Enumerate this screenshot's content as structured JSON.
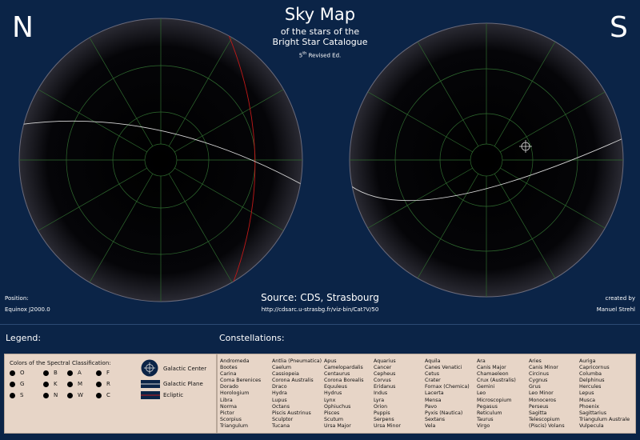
{
  "hemispheres": {
    "north": "N",
    "south": "S"
  },
  "title": {
    "main": "Sky Map",
    "line2": "of the stars of the",
    "line3": "Bright Star Catalogue",
    "edition_sup": "5th",
    "edition_text": "Revised Ed."
  },
  "position": {
    "label": "Position:",
    "equinox": "Equinox J2000.0"
  },
  "source": {
    "label": "Source: CDS, Strasbourg",
    "url": "http://cdsarc.u-strasbg.fr/viz-bin/Cat?V/50"
  },
  "credit": {
    "line1": "created by",
    "line2": "Manuel Strehl"
  },
  "legend": {
    "heading": "Legend:",
    "spectral_title": "Colors of the Spectral Classification:",
    "classes": [
      "O",
      "B",
      "A",
      "F",
      "G",
      "K",
      "M",
      "R",
      "S",
      "N",
      "W",
      "C"
    ],
    "galactic_center": "Galactic Center",
    "galactic_plane": "Galactic Plane",
    "ecliptic": "Ecliptic"
  },
  "constellations": {
    "heading": "Constellations:",
    "columns": [
      [
        "Andromeda",
        "Bootes",
        "Carina",
        "Coma Berenices",
        "Dorado",
        "Horologium",
        "Libra",
        "Norma",
        "Pictor",
        "Scorpius",
        "Triangulum"
      ],
      [
        "Antlia (Pneumatica)",
        "Caelum",
        "Cassiopeia",
        "Corona Australis",
        "Draco",
        "Hydra",
        "Lupus",
        "Octans",
        "Piscis Austrinus",
        "Sculptor",
        "Tucana"
      ],
      [
        "Apus",
        "Camelopardalis",
        "Centaurus",
        "Corona Borealis",
        "Equuleus",
        "Hydrus",
        "Lynx",
        "Ophiuchus",
        "Pisces",
        "Scutum",
        "Ursa Major"
      ],
      [
        "Aquarius",
        "Cancer",
        "Cepheus",
        "Corvus",
        "Eridanus",
        "Indus",
        "Lyra",
        "Orion",
        "Puppis",
        "Serpens",
        "Ursa Minor"
      ],
      [
        "Aquila",
        "Canes Venatici",
        "Cetus",
        "Crater",
        "Fornax (Chemica)",
        "Lacerta",
        "Mensa",
        "Pavo",
        "Pyxis (Nautica)",
        "Sextans",
        "Vela"
      ],
      [
        "Ara",
        "Canis Major",
        "Chamaeleon",
        "Crux (Australis)",
        "Gemini",
        "Leo",
        "Microscopium",
        "Pegasus",
        "Reticulum",
        "Taurus",
        "Virgo"
      ],
      [
        "Aries",
        "Canis Minor",
        "Circinus",
        "Cygnus",
        "Grus",
        "Leo Minor",
        "Monoceros",
        "Perseus",
        "Sagitta",
        "Telescopium",
        "(Piscis) Volans"
      ],
      [
        "Auriga",
        "Capricornus",
        "Columba",
        "Delphinus",
        "Hercules",
        "Lepus",
        "Musca",
        "Phoenix",
        "Sagittarius",
        "Triangulum Australe",
        "Vulpecula"
      ]
    ]
  },
  "colors": {
    "background": "#0b2447",
    "panel": "#e7d5c7",
    "grid": "#2f6b2f",
    "ecliptic": "#c01818",
    "galactic": "#d8d8d8"
  }
}
